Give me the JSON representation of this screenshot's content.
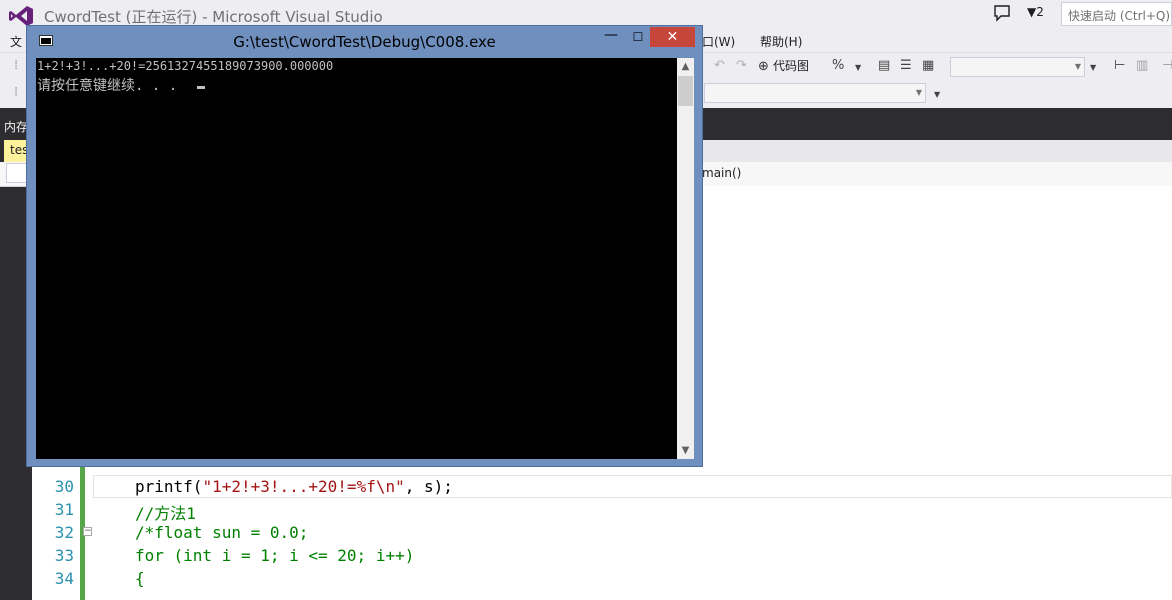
{
  "vs": {
    "title": "CwordTest (正在运行) - Microsoft Visual Studio",
    "notification_count": "2",
    "quick_launch_placeholder": "快速启动 (Ctrl+Q)"
  },
  "menu": {
    "file_partial": "文",
    "window_partial": "窗口(W)",
    "help": "帮助(H)"
  },
  "toolbar": {
    "code_map_label": "代码图"
  },
  "left_tabs": {
    "memory_partial": "内存",
    "doc_tab_partial": "tes"
  },
  "navbar": {
    "function": "main()"
  },
  "console": {
    "title": "G:\\test\\CwordTest\\Debug\\C008.exe",
    "output_line1": "1+2!+3!...+20!=2561327455189073900.000000",
    "output_line2": "请按任意键继续. . . "
  },
  "editor": {
    "lines": [
      {
        "number": "30",
        "code_parts": [
          "printf(",
          "\"1+2!+3!...+20!=%f\\n\"",
          ", s);"
        ]
      },
      {
        "number": "31",
        "comment": "//方法1"
      },
      {
        "number": "32",
        "comment": "/*float sun = 0.0;"
      },
      {
        "number": "33",
        "comment": "for (int i = 1; i <= 20; i++)"
      },
      {
        "number": "34",
        "comment": "{"
      }
    ]
  },
  "colors": {
    "vs_chrome": "#eeeef2",
    "dark_band": "#2d2d30",
    "console_frame": "#6f8fbf",
    "close_button": "#c7463c",
    "line_number": "#2b91af",
    "string": "#a31515",
    "comment": "#008000",
    "changed_bar": "#57a64a"
  },
  "icons": [
    "vs-logo-icon",
    "notification-icon",
    "filter-icon",
    "console-app-icon",
    "minimize-icon",
    "maximize-icon",
    "close-icon",
    "scroll-up-icon",
    "scroll-down-icon",
    "collapse-icon"
  ]
}
